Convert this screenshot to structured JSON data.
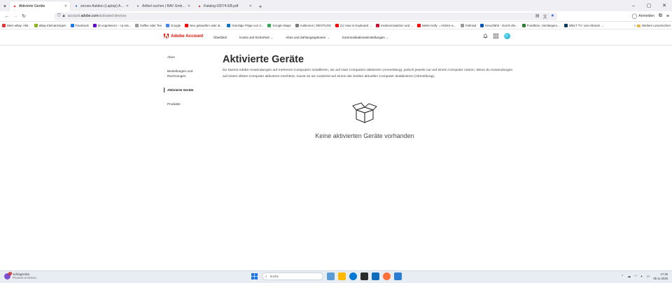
{
  "browser": {
    "tabs": [
      {
        "title": "Aktivierte Geräte",
        "active": true,
        "favicon": "adobe-icon",
        "color": "#eb1000"
      },
      {
        "title": "zeroes Auktion (Laptop) APPLE, i",
        "active": false,
        "favicon": "auction-icon",
        "color": "#1a5fd8"
      },
      {
        "title": "Artikel suchen | BAV GmbH Verste",
        "active": false,
        "favicon": "page-icon",
        "color": "#777777"
      },
      {
        "title": "Katalog-03074-EB.pdf",
        "active": false,
        "favicon": "pdf-icon",
        "color": "#d42c2c"
      }
    ],
    "url_prefix": "account.",
    "url_domain": "adobe.com",
    "url_path": "/activated-devices",
    "account_label": "Anmelden"
  },
  "bookmarks": [
    {
      "label": "Mein eBay: Akti..",
      "color": "#e53238"
    },
    {
      "label": "eBay Kleinanzeigen",
      "color": "#86b817"
    },
    {
      "label": "Facebook",
      "color": "#1877f2"
    },
    {
      "label": "(8 ungelesen) – ca-sta...",
      "color": "#6001d2"
    },
    {
      "label": "Kaffee oder Tee",
      "color": "#999999"
    },
    {
      "label": "Google",
      "color": "#4285f4"
    },
    {
      "label": "Neu gekauften oder al...",
      "color": "#ff0000"
    },
    {
      "label": "Günstige Flüge von 2...",
      "color": "#0a73c5"
    },
    {
      "label": "Google Maps",
      "color": "#34a853"
    },
    {
      "label": "Auktionen | RESTUOS",
      "color": "#7a7a7a"
    },
    {
      "label": "(1) How to Keyboard ...",
      "color": "#ff0000"
    },
    {
      "label": "insolvenzauktion und ...",
      "color": "#c8102e"
    },
    {
      "label": "Mette Kelly ↔Hirnkn~L...",
      "color": "#ff0000"
    },
    {
      "label": "Fahrrad",
      "color": "#999999"
    },
    {
      "label": "Kreuzfahrt - Durch die...",
      "color": "#0057b8"
    },
    {
      "label": "Fundbüro, Versteigeru...",
      "color": "#2e7d32"
    },
    {
      "label": "WELT TV: Live-Stream ...",
      "color": "#003a5d"
    }
  ],
  "bookmarks_more": "Weitere Lesezeichen",
  "adobe": {
    "logo_text": "Adobe Account",
    "nav": [
      {
        "label": "Überblick",
        "dropdown": false
      },
      {
        "label": "Konto und Sicherheit",
        "dropdown": true
      },
      {
        "label": "Abos und Zahlungsoptionen",
        "dropdown": true
      },
      {
        "label": "Kommunikationseinstellungen",
        "dropdown": true
      }
    ]
  },
  "sidebar": [
    {
      "label": "Abos",
      "active": false
    },
    {
      "label": "Bestellungen und Rechnungen",
      "active": false
    },
    {
      "label": "Aktivierte Geräte",
      "active": true
    },
    {
      "label": "Produkte",
      "active": false
    }
  ],
  "main": {
    "title": "Aktivierte Geräte",
    "description": "Du kannst Adobe-Anwendungen auf mehreren Computern installieren, sie auf zwei Computern aktivieren (Anmeldung), jedoch jeweils nur auf einem Computer nutzen. Wenn du Anwendungen auf einem dritten Computer aktivieren möchtest, musst du sie zunächst auf einem der beiden aktuellen Computer deaktivieren (Abmeldung).",
    "empty_text": "Keine aktivierten Geräte vorhanden"
  },
  "taskbar": {
    "weather_title": "Schlagzeilen",
    "weather_sub": "Prozess in Dresd...",
    "weather_badge": "1",
    "search_label": "Suche",
    "time": "17:26",
    "date": "06.11.2025"
  },
  "colors": {
    "adobe_red": "#eb1000",
    "browser_accent": "#1a5fd8"
  }
}
